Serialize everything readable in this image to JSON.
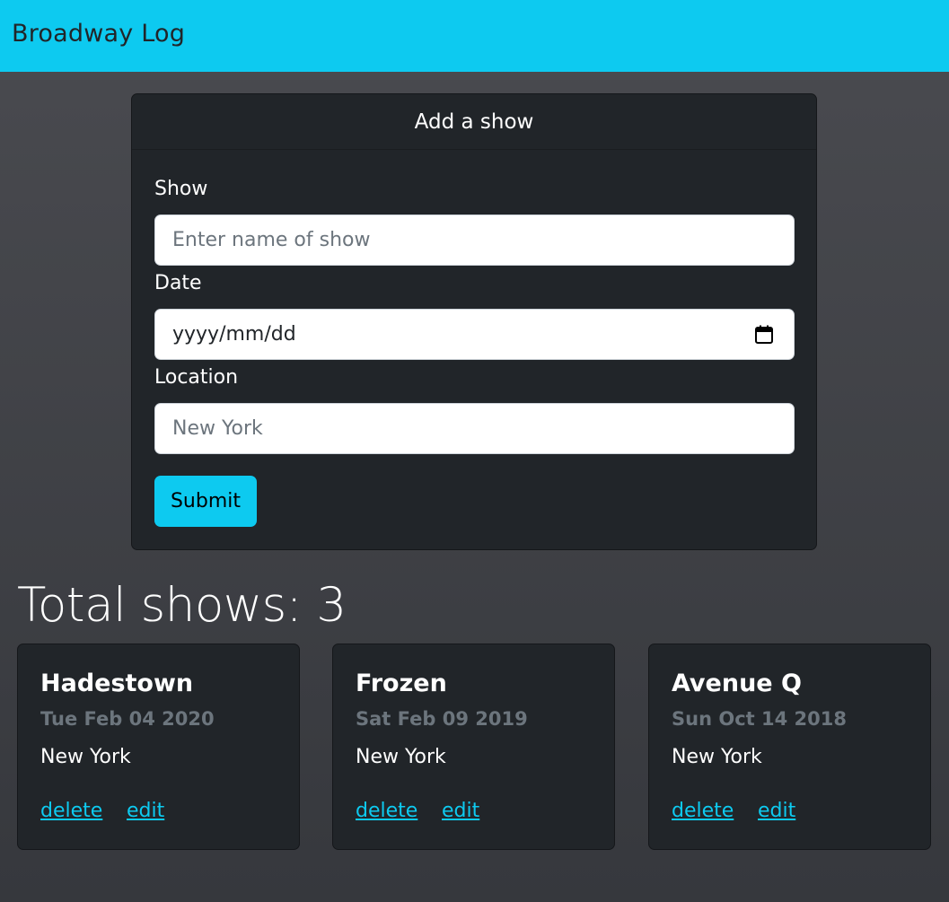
{
  "navbar": {
    "brand": "Broadway Log",
    "background": "#0dcaf0"
  },
  "form": {
    "header": "Add a show",
    "show_label": "Show",
    "show_placeholder": "Enter name of show",
    "date_label": "Date",
    "date_placeholder": "yyyy/mm/dd",
    "location_label": "Location",
    "location_placeholder": "New York",
    "submit_label": "Submit"
  },
  "summary": {
    "total_text": "Total shows: 3"
  },
  "shows": [
    {
      "title": "Hadestown",
      "date": "Tue Feb 04 2020",
      "location": "New York",
      "delete_label": "delete",
      "edit_label": "edit"
    },
    {
      "title": "Frozen",
      "date": "Sat Feb 09 2019",
      "location": "New York",
      "delete_label": "delete",
      "edit_label": "edit"
    },
    {
      "title": "Avenue Q",
      "date": "Sun Oct 14 2018",
      "location": "New York",
      "delete_label": "delete",
      "edit_label": "edit"
    }
  ],
  "icons": {
    "date_input": "calendar-icon"
  },
  "colors": {
    "accent": "#0dcaf0",
    "card_bg": "#212529",
    "muted": "#6c757d"
  }
}
